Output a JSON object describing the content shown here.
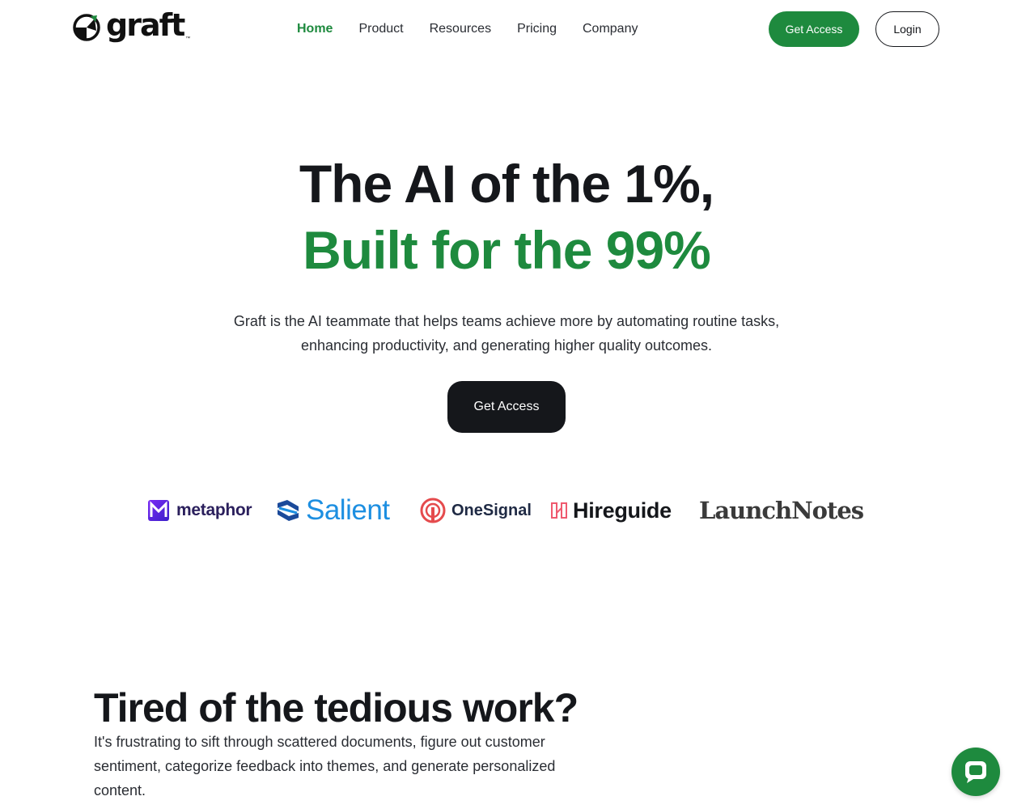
{
  "brand": {
    "name": "graft",
    "tm": "™",
    "accent_color": "#1e8a3e",
    "dark_color": "#15171b"
  },
  "nav": {
    "items": [
      {
        "label": "Home",
        "active": true
      },
      {
        "label": "Product",
        "active": false
      },
      {
        "label": "Resources",
        "active": false
      },
      {
        "label": "Pricing",
        "active": false
      },
      {
        "label": "Company",
        "active": false
      }
    ]
  },
  "header": {
    "get_access_label": "Get Access",
    "login_label": "Login"
  },
  "hero": {
    "title_line1": "The AI of the 1%,",
    "title_line2": "Built for the 99%",
    "subtitle": "Graft is the AI teammate that helps teams achieve more by automating routine tasks, enhancing productivity, and generating higher quality outcomes.",
    "cta_label": "Get Access"
  },
  "customer_logos": [
    {
      "name": "metaphor",
      "icon": "metaphor-logo-icon"
    },
    {
      "name": "Salient",
      "icon": "salient-logo-icon"
    },
    {
      "name": "OneSignal",
      "icon": "onesignal-logo-icon"
    },
    {
      "name": "Hireguide",
      "icon": "hireguide-logo-icon"
    },
    {
      "name": "LaunchNotes",
      "icon": ""
    }
  ],
  "pain_section": {
    "title": "Tired of the tedious work?",
    "body": "It's frustrating to sift through scattered documents, figure out customer sentiment, categorize feedback into themes, and generate personalized content."
  },
  "chat_widget": {
    "icon": "chat-bubble-icon"
  }
}
